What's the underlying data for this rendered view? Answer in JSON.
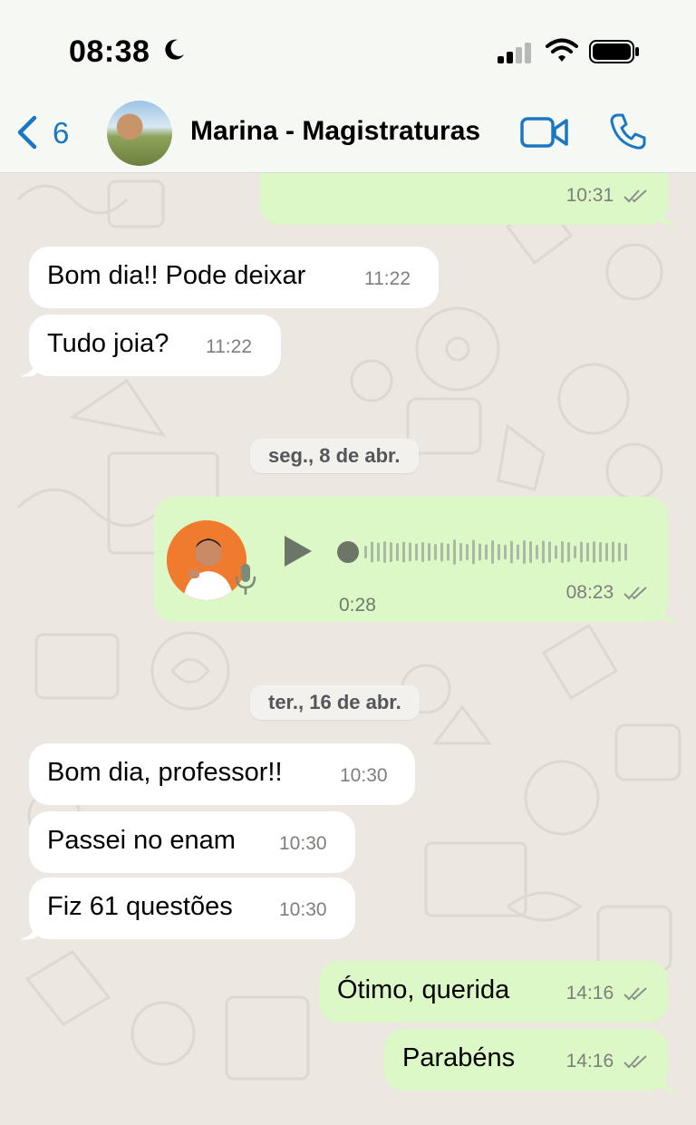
{
  "status_bar": {
    "time": "08:38"
  },
  "header": {
    "back_count": "6",
    "contact_name": "Marina - Magistraturas"
  },
  "messages": {
    "m0_time": "10:31",
    "m1": {
      "text": "Bom dia!! Pode deixar",
      "time": "11:22"
    },
    "m2": {
      "text": "Tudo joia?",
      "time": "11:22"
    },
    "date1": "seg., 8 de abr.",
    "voice": {
      "duration": "0:28",
      "time": "08:23"
    },
    "date2": "ter., 16 de abr.",
    "m3": {
      "text": "Bom dia, professor!!",
      "time": "10:30"
    },
    "m4": {
      "text": "Passei no enam",
      "time": "10:30"
    },
    "m5": {
      "text": "Fiz 61 questões",
      "time": "10:30"
    },
    "m6": {
      "text": "Ótimo, querida",
      "time": "14:16"
    },
    "m7": {
      "text": "Parabéns",
      "time": "14:16"
    }
  },
  "colors": {
    "accent": "#1a78c2",
    "outgoing_bubble": "#dcf8c6",
    "incoming_bubble": "#ffffff",
    "background": "#ece7e1"
  },
  "icons": {
    "back": "chevron-left-icon",
    "video": "video-camera-icon",
    "call": "phone-icon",
    "play": "play-icon",
    "mic": "microphone-icon",
    "read": "double-check-icon"
  }
}
